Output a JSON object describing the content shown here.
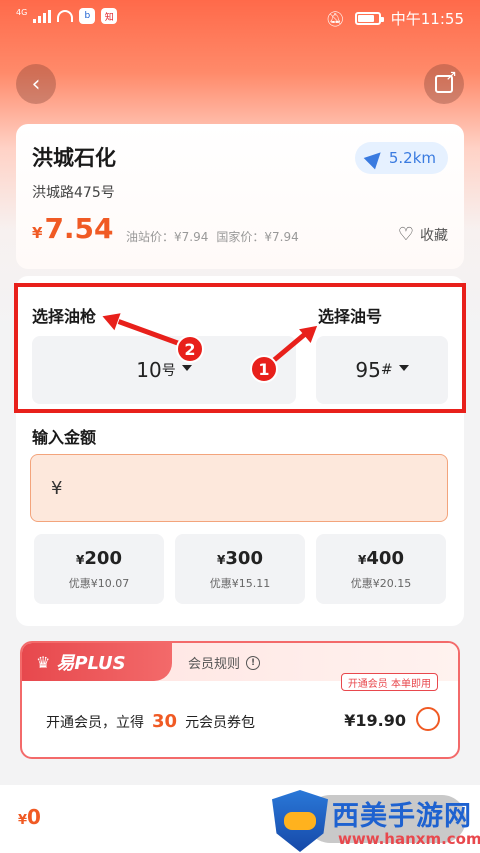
{
  "status_bar": {
    "network": "4G",
    "time": "中午11:55",
    "app_icon_1": "b",
    "app_icon_2": "知"
  },
  "nav": {
    "back_glyph": "‹"
  },
  "station": {
    "name": "洪城石化",
    "address": "洪城路475号",
    "distance": "5.2km",
    "currency": "¥",
    "price": "7.54",
    "station_price": "油站价：¥7.94",
    "national_price": "国家价：¥7.94",
    "favorite_label": "收藏"
  },
  "selection": {
    "gun_label": "选择油枪",
    "gun_value": "10",
    "gun_suffix": "号",
    "fuel_label": "选择油号",
    "fuel_value": "95",
    "fuel_suffix": "#",
    "badge_1": "1",
    "badge_2": "2"
  },
  "amount": {
    "label": "输入金额",
    "input_prefix": "¥",
    "presets": [
      {
        "amount": "200",
        "discount": "优惠¥10.07"
      },
      {
        "amount": "300",
        "discount": "优惠¥15.11"
      },
      {
        "amount": "400",
        "discount": "优惠¥20.15"
      }
    ],
    "preset_currency": "¥"
  },
  "plus": {
    "tag": "易PLUS",
    "rules": "会员规则",
    "badge": "开通会员 本单即用",
    "desc_prefix": "开通会员，立得",
    "desc_count": "30",
    "desc_suffix": "元会员券包",
    "price": "¥19.90"
  },
  "bottom": {
    "total_currency": "¥",
    "total": "0"
  },
  "watermark": {
    "title": "西美手游网",
    "url": "www.hanxm.com"
  },
  "colors": {
    "accent": "#f05a24",
    "annotation_red": "#e8201b",
    "distance_blue": "#3a7be0"
  }
}
